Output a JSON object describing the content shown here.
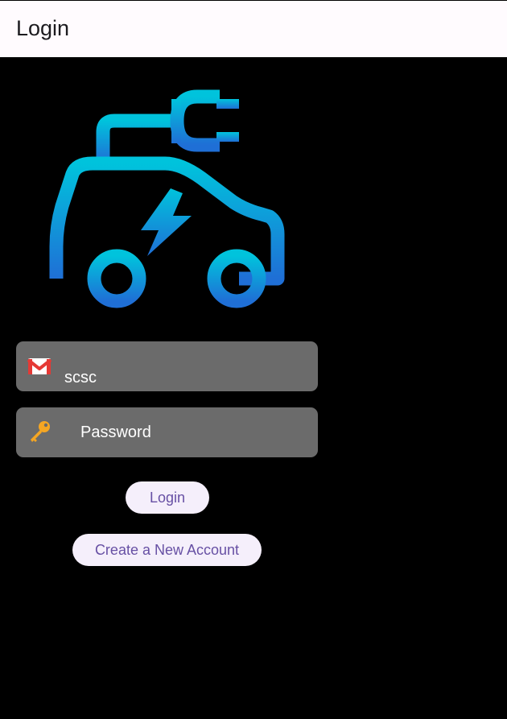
{
  "app_bar": {
    "title": "Login"
  },
  "logo": {
    "icon": "electric-car-plug-icon",
    "gradient_top": "#00c3dc",
    "gradient_bottom": "#1f6fd6"
  },
  "form": {
    "email": {
      "icon": "gmail-icon",
      "value": "scsc"
    },
    "password": {
      "icon": "key-icon",
      "placeholder": "Password",
      "value": ""
    }
  },
  "actions": {
    "login_label": "Login",
    "create_account_label": "Create a New Account"
  },
  "colors": {
    "background": "#000000",
    "app_bar": "#fffbfe",
    "field": "#6b6b6b",
    "button_bg": "#f5effb",
    "button_text": "#6750a4"
  }
}
